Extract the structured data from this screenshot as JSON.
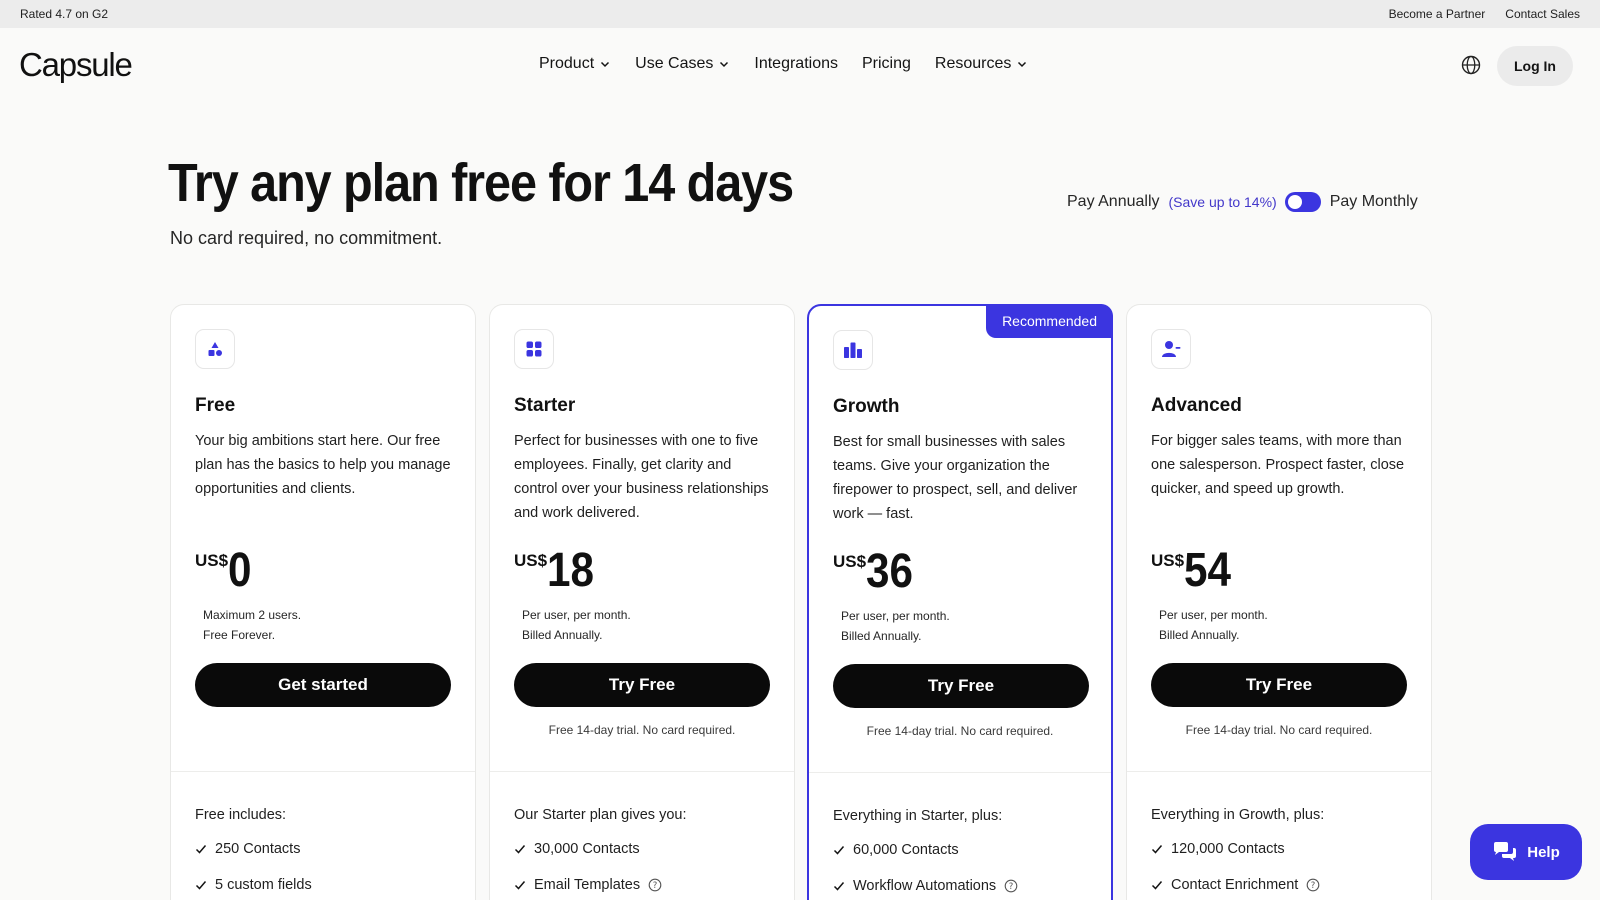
{
  "topbar": {
    "rating": "Rated 4.7 on G2",
    "partner": "Become a Partner",
    "contact": "Contact Sales"
  },
  "nav": {
    "logo": "Capsule",
    "items": [
      {
        "label": "Product",
        "dropdown": true
      },
      {
        "label": "Use Cases",
        "dropdown": true
      },
      {
        "label": "Integrations",
        "dropdown": false
      },
      {
        "label": "Pricing",
        "dropdown": false
      },
      {
        "label": "Resources",
        "dropdown": true
      }
    ],
    "login": "Log In"
  },
  "hero": {
    "title": "Try any plan free for 14 days",
    "subtitle": "No card required, no commitment."
  },
  "billing": {
    "annual": "Pay Annually",
    "save": "(Save up to 14%)",
    "monthly": "Pay Monthly"
  },
  "plans": [
    {
      "name": "Free",
      "icon": "shapes-icon",
      "description": "Your big ambitions start here. Our free plan has the basics to help you manage opportunities and clients.",
      "currency": "US$",
      "price": "0",
      "note1": "Maximum 2 users.",
      "note2": "Free Forever.",
      "cta": "Get started",
      "trial": "",
      "includes_title": "Free includes:",
      "features": [
        {
          "label": "250 Contacts",
          "info": false
        },
        {
          "label": "5 custom fields",
          "info": false
        }
      ]
    },
    {
      "name": "Starter",
      "icon": "grid-icon",
      "description": "Perfect for businesses with one to five employees. Finally, get clarity and control over your business relationships and work delivered.",
      "currency": "US$",
      "price": "18",
      "note1": "Per user, per month.",
      "note2": "Billed Annually.",
      "cta": "Try Free",
      "trial": "Free 14-day trial. No card required.",
      "includes_title": "Our Starter plan gives you:",
      "features": [
        {
          "label": "30,000 Contacts",
          "info": false
        },
        {
          "label": "Email Templates",
          "info": true
        }
      ]
    },
    {
      "name": "Growth",
      "icon": "bar-chart-icon",
      "badge": "Recommended",
      "description": "Best for small businesses with sales teams. Give your organization the firepower to prospect, sell, and deliver work — fast.",
      "currency": "US$",
      "price": "36",
      "note1": "Per user, per month.",
      "note2": "Billed Annually.",
      "cta": "Try Free",
      "trial": "Free 14-day trial. No card required.",
      "includes_title": "Everything in Starter, plus:",
      "features": [
        {
          "label": "60,000 Contacts",
          "info": false
        },
        {
          "label": "Workflow Automations",
          "info": true
        }
      ]
    },
    {
      "name": "Advanced",
      "icon": "user-icon",
      "description": "For bigger sales teams, with more than one salesperson. Prospect faster, close quicker, and speed up growth.",
      "currency": "US$",
      "price": "54",
      "note1": "Per user, per month.",
      "note2": "Billed Annually.",
      "cta": "Try Free",
      "trial": "Free 14-day trial. No card required.",
      "includes_title": "Everything in Growth, plus:",
      "features": [
        {
          "label": "120,000 Contacts",
          "info": false
        },
        {
          "label": "Contact Enrichment",
          "info": true
        }
      ]
    }
  ],
  "help": {
    "label": "Help",
    "icon": "chat-bubbles-icon"
  },
  "colors": {
    "accent": "#3b35e0",
    "cta": "#0a0a0a",
    "background": "#fafaf9"
  }
}
